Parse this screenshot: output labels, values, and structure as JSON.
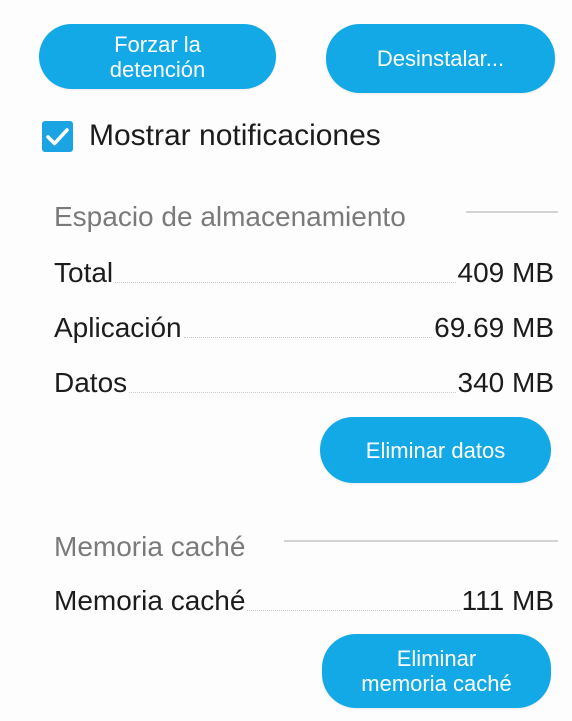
{
  "buttons": {
    "force_stop": "Forzar la\ndetención",
    "uninstall": "Desinstalar...",
    "clear_data": "Eliminar datos",
    "clear_cache": "Eliminar\nmemoria caché"
  },
  "notifications": {
    "label": "Mostrar notificaciones",
    "checked": true
  },
  "storage": {
    "title": "Espacio de almacenamiento",
    "rows": [
      {
        "label": "Total",
        "value": "409 MB"
      },
      {
        "label": "Aplicación",
        "value": "69.69 MB"
      },
      {
        "label": "Datos",
        "value": "340 MB"
      }
    ]
  },
  "cache": {
    "title": "Memoria caché",
    "rows": [
      {
        "label": "Memoria caché",
        "value": "111 MB"
      }
    ]
  },
  "colors": {
    "accent": "#12a9e6",
    "section_title": "#7a7a7a",
    "text": "#1c1c1c"
  }
}
